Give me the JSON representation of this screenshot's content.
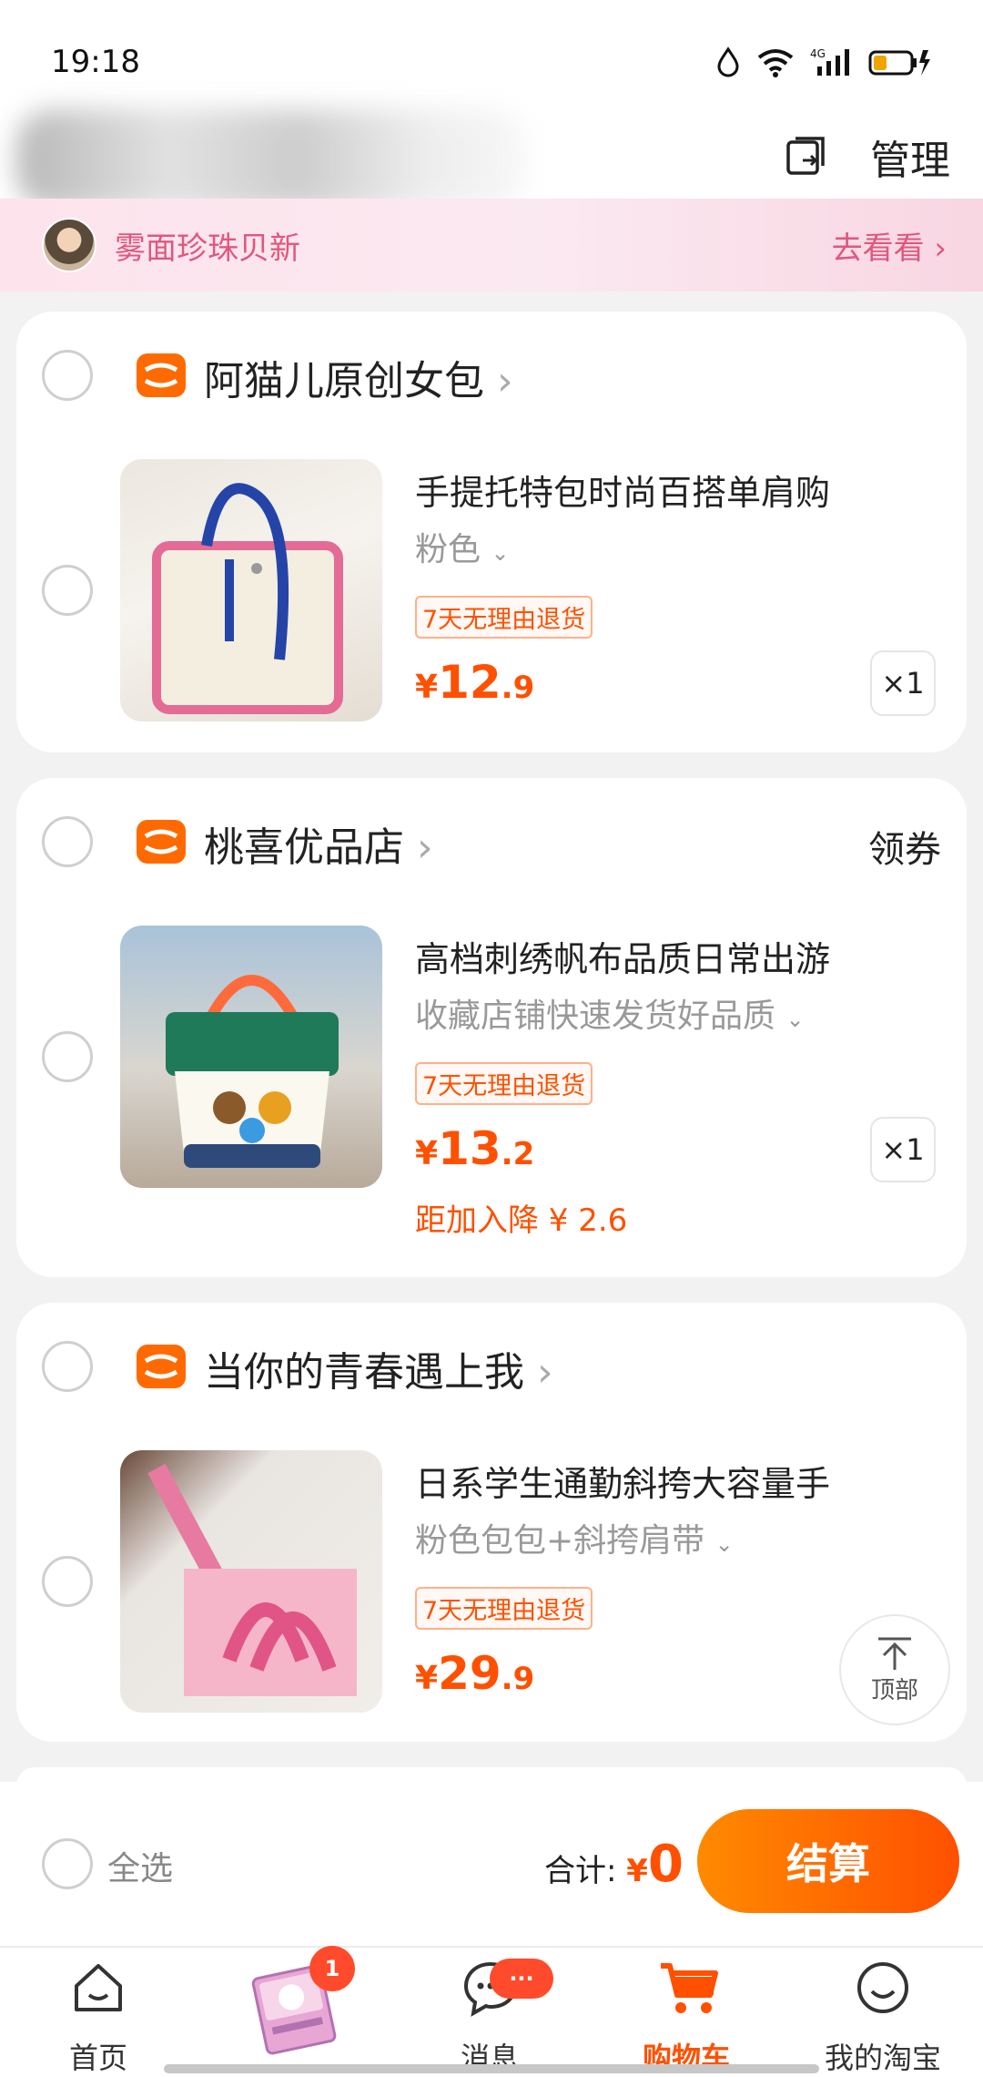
{
  "status": {
    "time": "19:18",
    "network": "4G"
  },
  "header": {
    "manage_label": "管理",
    "icon": "copy-switch-icon"
  },
  "banner": {
    "text": "雾面珍珠贝新",
    "link": "去看看"
  },
  "shops": [
    {
      "name": "阿猫儿原创女包",
      "coupon": "",
      "item": {
        "title": "手提托特包时尚百搭单肩购",
        "spec": "粉色",
        "tag": "7天无理由退货",
        "currency": "¥",
        "price_int": "12",
        "price_dec": ".9",
        "qty": "×1",
        "promo": ""
      }
    },
    {
      "name": "桃喜优品店",
      "coupon": "领券",
      "item": {
        "title": "高档刺绣帆布品质日常出游",
        "spec": "收藏店铺快速发货好品质",
        "tag": "7天无理由退货",
        "currency": "¥",
        "price_int": "13",
        "price_dec": ".2",
        "qty": "×1",
        "promo": "距加入降 ¥ 2.6"
      }
    },
    {
      "name": "当你的青春遇上我",
      "coupon": "",
      "item": {
        "title": "日系学生通勤斜挎大容量手",
        "spec": "粉色包包+斜挎肩带",
        "tag": "7天无理由退货",
        "currency": "¥",
        "price_int": "29",
        "price_dec": ".9",
        "qty": "",
        "promo": ""
      }
    }
  ],
  "backtop": {
    "label": "顶部"
  },
  "checkout": {
    "select_all": "全选",
    "total_label": "合计:",
    "currency": "¥",
    "total": "0",
    "pay_label": "结算"
  },
  "tabbar": {
    "tabs": [
      {
        "label": "首页",
        "icon": "home-icon"
      },
      {
        "label": "",
        "icon": "promo-sticker-icon",
        "badge": "1"
      },
      {
        "label": "消息",
        "icon": "message-icon",
        "badge": "···"
      },
      {
        "label": "购物车",
        "icon": "cart-icon",
        "active": true
      },
      {
        "label": "我的淘宝",
        "icon": "profile-icon"
      }
    ]
  },
  "colors": {
    "accent": "#ff5000",
    "banner_text": "#e0577e"
  }
}
